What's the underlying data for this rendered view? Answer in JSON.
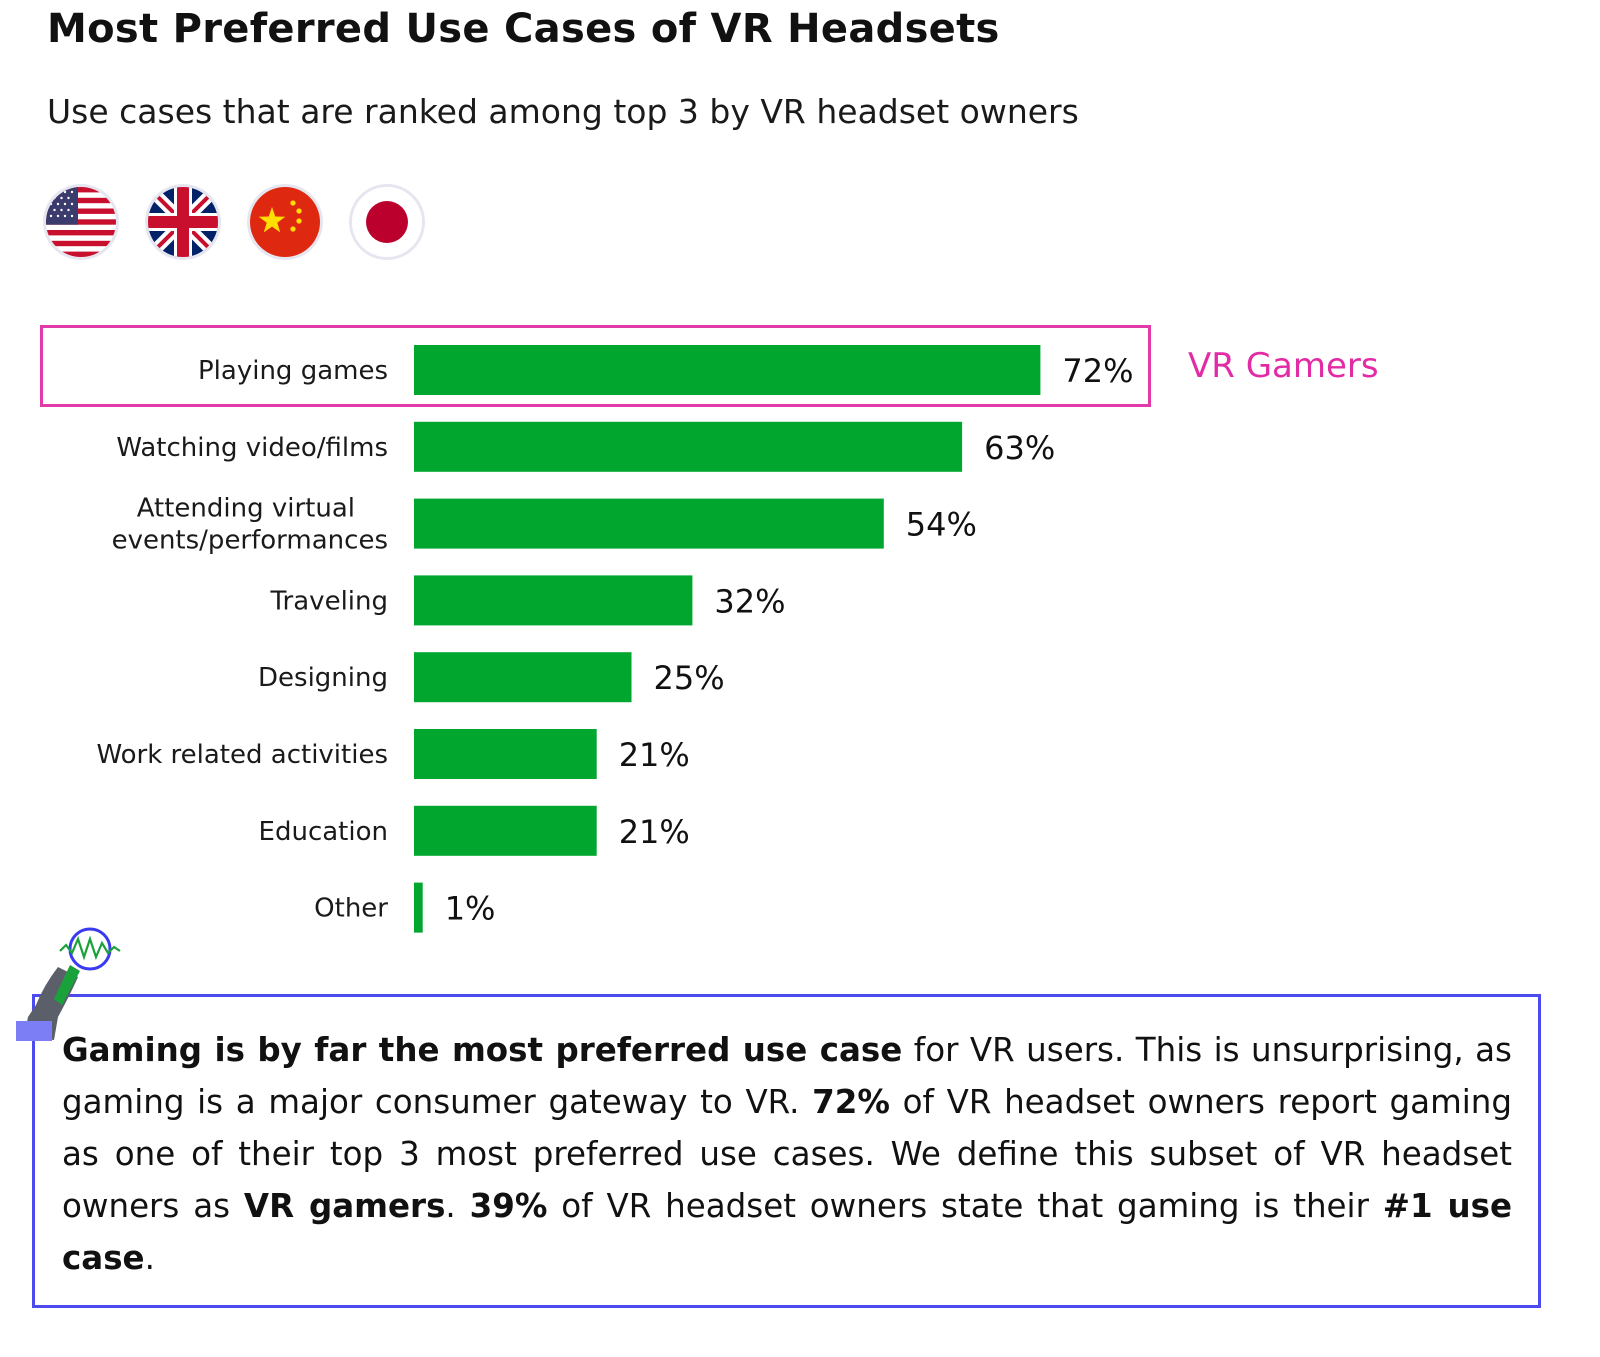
{
  "header": {
    "title": "Most Preferred Use Cases of VR Headsets",
    "subtitle": "Use cases that are ranked among top 3 by VR headset owners"
  },
  "flags": [
    {
      "country": "United States",
      "icon": "us-flag-icon"
    },
    {
      "country": "United Kingdom",
      "icon": "uk-flag-icon"
    },
    {
      "country": "China",
      "icon": "china-flag-icon"
    },
    {
      "country": "Japan",
      "icon": "japan-flag-icon"
    }
  ],
  "highlight": {
    "label": "VR Gamers",
    "color": "#e22ca6"
  },
  "colors": {
    "bar": "#00a62e",
    "highlight_border": "#e23ba9",
    "callout_border": "#4b4bf0"
  },
  "chart_data": {
    "type": "bar",
    "orientation": "horizontal",
    "title": "Most Preferred Use Cases of VR Headsets",
    "subtitle": "Use cases that are ranked among top 3 by VR headset owners",
    "xlabel": "",
    "ylabel": "",
    "xlim": [
      0,
      100
    ],
    "grid": false,
    "categories": [
      [
        "Playing games"
      ],
      [
        "Watching video/films"
      ],
      [
        "Attending virtual",
        "events/performances"
      ],
      [
        "Traveling"
      ],
      [
        "Designing"
      ],
      [
        "Work related activities"
      ],
      [
        "Education"
      ],
      [
        "Other"
      ]
    ],
    "values": [
      72,
      63,
      54,
      32,
      25,
      21,
      21,
      1
    ],
    "value_labels": [
      "72%",
      "63%",
      "54%",
      "32%",
      "25%",
      "21%",
      "21%",
      "1%"
    ],
    "highlighted_category_index": 0,
    "annotation": "VR Gamers"
  },
  "callout": {
    "segments": [
      {
        "text": "Gaming is by far the most preferred use case",
        "bold": true
      },
      {
        "text": " for VR users. This is unsurprising, as gaming is a major consumer gateway to VR. ",
        "bold": false
      },
      {
        "text": "72%",
        "bold": true
      },
      {
        "text": " of VR headset owners report gaming as one of their top 3 most preferred use cases. We define this subset of VR headset owners as ",
        "bold": false
      },
      {
        "text": "VR gamers",
        "bold": true
      },
      {
        "text": ". ",
        "bold": false
      },
      {
        "text": "39%",
        "bold": true
      },
      {
        "text": " of VR headset owners state that gaming is their ",
        "bold": false
      },
      {
        "text": "#1 use case",
        "bold": true
      },
      {
        "text": ".",
        "bold": false
      }
    ]
  }
}
